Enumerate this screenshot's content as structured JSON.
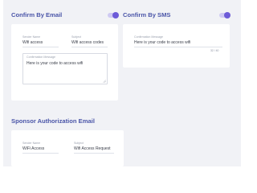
{
  "email_section": {
    "title": "Confirm By Email",
    "sender_name": {
      "label": "Sender Name",
      "value": "Wifi access"
    },
    "subject": {
      "label": "Subject",
      "value": "Wifi access codes"
    },
    "confirmation_message": {
      "label": "Confirmation Message",
      "value": "Here is your code to access wifi"
    },
    "toggle_on": true
  },
  "sms_section": {
    "title": "Confirm By SMS",
    "confirmation_message": {
      "label": "Confirmation Message",
      "value": "Here is your code to access wifi",
      "counter": "32 / 40"
    },
    "toggle_on": true
  },
  "sponsor_section": {
    "title": "Sponsor Authorization Email",
    "sender_name": {
      "label": "Sender Name",
      "value": "WiFi Access"
    },
    "subject": {
      "label": "Subject",
      "value": "Wifi Access Request"
    }
  },
  "colors": {
    "title": "#4a55a8",
    "toggle_track": "#cfcaf3",
    "toggle_knob": "#6d5bd8",
    "background": "#f1f2f6"
  },
  "icons": [
    "toggle-on-icon",
    "textarea-resize-icon"
  ]
}
